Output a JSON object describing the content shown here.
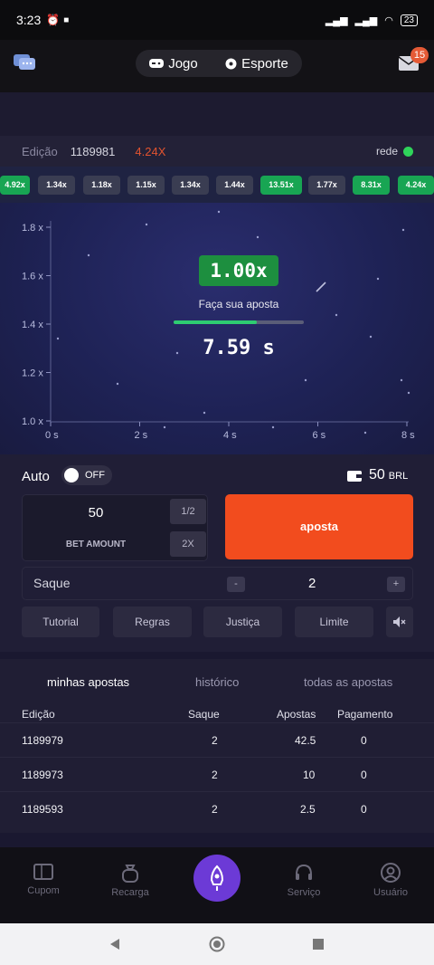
{
  "status_bar": {
    "time": "3:23",
    "battery": "23"
  },
  "header": {
    "tabs": {
      "jogo": "Jogo",
      "esporte": "Esporte"
    },
    "mail_badge": "15"
  },
  "edition_bar": {
    "label": "Edição",
    "number": "1189981",
    "last_multiplier": "4.24X",
    "network_label": "rede"
  },
  "history_chips": [
    {
      "value": "4.92x",
      "color": "green"
    },
    {
      "value": "1.34x",
      "color": "gray"
    },
    {
      "value": "1.18x",
      "color": "gray"
    },
    {
      "value": "1.15x",
      "color": "gray"
    },
    {
      "value": "1.34x",
      "color": "gray"
    },
    {
      "value": "1.44x",
      "color": "gray"
    },
    {
      "value": "13.51x",
      "color": "green"
    },
    {
      "value": "1.77x",
      "color": "gray"
    },
    {
      "value": "8.31x",
      "color": "green"
    },
    {
      "value": "4.24x",
      "color": "green"
    }
  ],
  "graph": {
    "y_ticks": [
      "1.8 x",
      "1.6 x",
      "1.4 x",
      "1.2 x",
      "1.0 x"
    ],
    "x_ticks": [
      "0 s",
      "2 s",
      "4 s",
      "6 s",
      "8 s"
    ],
    "multiplier": "1.00x",
    "prompt": "Faça sua aposta",
    "countdown_progress": 0.64,
    "countdown": "7.59 s"
  },
  "controls": {
    "auto_label": "Auto",
    "auto_state": "OFF",
    "balance": "50",
    "currency": "BRL",
    "bet_value": "50",
    "half_label": "1/2",
    "bet_amount_label": "BET AMOUNT",
    "double_label": "2X",
    "aposta_label": "aposta",
    "saque_label": "Saque",
    "minus": "-",
    "plus": "+",
    "saque_value": "2",
    "buttons": {
      "tutorial": "Tutorial",
      "regras": "Regras",
      "justica": "Justiça",
      "limite": "Limite"
    }
  },
  "bets": {
    "tabs": {
      "mine": "minhas apostas",
      "history": "histórico",
      "all": "todas as apostas"
    },
    "headers": {
      "edition": "Edição",
      "saque": "Saque",
      "apostas": "Apostas",
      "pagamento": "Pagamento"
    },
    "rows": [
      {
        "edition": "1189979",
        "saque": "2",
        "apostas": "42.5",
        "pagamento": "0"
      },
      {
        "edition": "1189973",
        "saque": "2",
        "apostas": "10",
        "pagamento": "0"
      },
      {
        "edition": "1189593",
        "saque": "2",
        "apostas": "2.5",
        "pagamento": "0"
      }
    ]
  },
  "tab_bar": {
    "cupom": "Cupom",
    "recarga": "Recarga",
    "servico": "Serviço",
    "usuario": "Usuário"
  },
  "colors": {
    "accent": "#f24c1e",
    "green": "#18a553",
    "purple": "#6c3ad6"
  }
}
